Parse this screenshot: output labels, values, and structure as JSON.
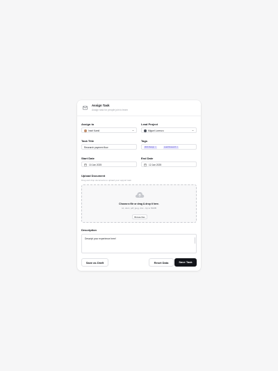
{
  "header": {
    "title": "Assign Task",
    "subtitle": "Assign task for people join to team",
    "icon": "mail-icon"
  },
  "fields": {
    "assign_to": {
      "label": "Assign to",
      "value": "Insel Kamil"
    },
    "lead_project": {
      "label": "Lead Project",
      "value": "Miguel Lorenzo"
    },
    "task_title": {
      "label": "Task Title",
      "value": "Research payment flow"
    },
    "tags": {
      "label": "Tags",
      "items": [
        "Web Design",
        "Lead Research"
      ]
    },
    "start_date": {
      "label": "Start Date",
      "value": "10 Jan 2025"
    },
    "end_date": {
      "label": "End Date",
      "value": "12 Jan 2025"
    }
  },
  "upload": {
    "label": "Upload Document",
    "subtitle": "Drag and drop documents to upload your support task",
    "title": "Choose a file or drag & drop it here.",
    "hint": "txt, docx, pdf, jpeg, xlsx - Up to 50MB",
    "browse_label": "Browse files"
  },
  "description": {
    "label": "Description",
    "value": "Descript your experience here!"
  },
  "actions": {
    "draft_label": "Save as Draft",
    "reset_label": "Reset Data",
    "save_label": "Save Task"
  },
  "colors": {
    "primary": "#121419",
    "tag_bg": "#e6e4ff",
    "tag_text": "#4b43c9"
  }
}
